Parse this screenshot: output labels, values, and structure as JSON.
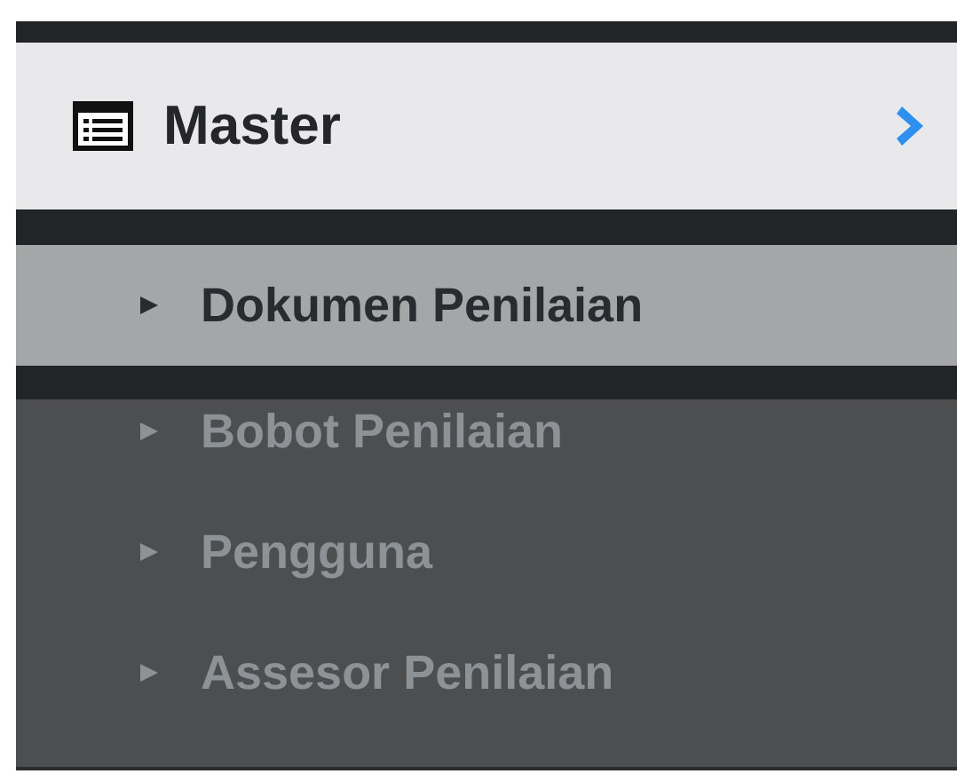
{
  "menu": {
    "title": "Master",
    "items": [
      {
        "label": "Dokumen Penilaian",
        "selected": true
      },
      {
        "label": "Bobot Penilaian",
        "selected": false
      },
      {
        "label": "Pengguna",
        "selected": false
      },
      {
        "label": "Assesor Penilaian",
        "selected": false
      }
    ]
  }
}
